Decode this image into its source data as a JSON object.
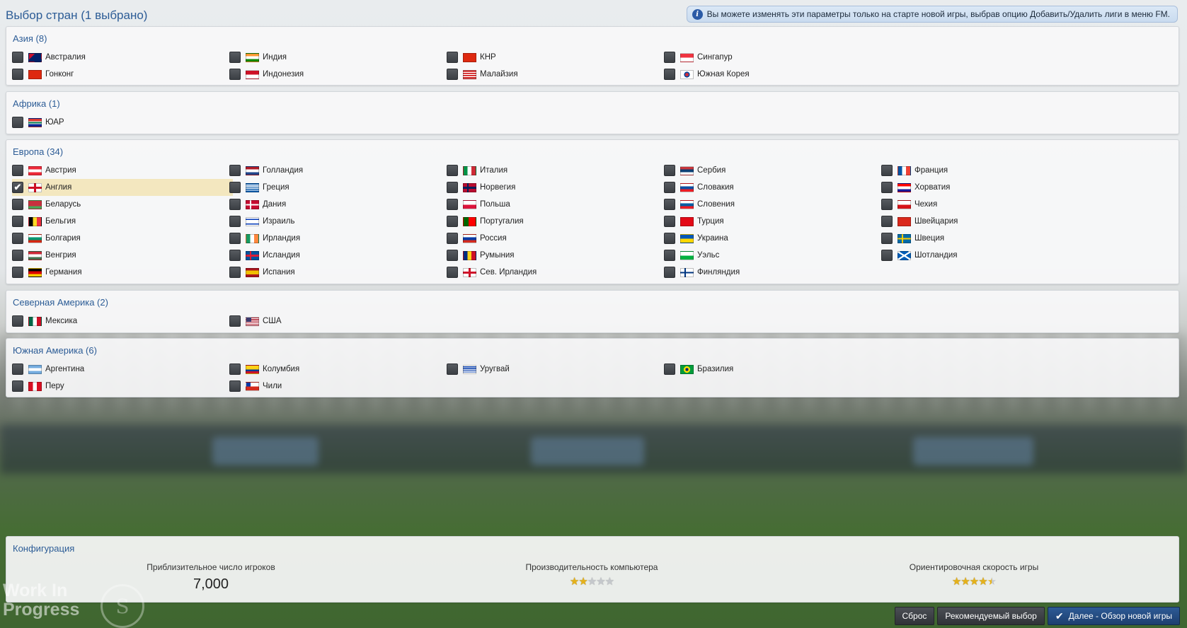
{
  "header": {
    "title": "Выбор стран (1 выбрано)",
    "notice": "Вы можете изменять эти параметры только на старте новой игры, выбрав опцию Добавить/Удалить лиги в меню FM."
  },
  "regions": {
    "asia": {
      "title": "Азия (8)",
      "items": [
        {
          "label": "Австралия",
          "checked": false
        },
        {
          "label": "Индия",
          "checked": false
        },
        {
          "label": "КНР",
          "checked": false
        },
        {
          "label": "Сингапур",
          "checked": false
        },
        {
          "label": "Гонконг",
          "checked": false
        },
        {
          "label": "Индонезия",
          "checked": false
        },
        {
          "label": "Малайзия",
          "checked": false
        },
        {
          "label": "Южная Корея",
          "checked": false
        }
      ]
    },
    "africa": {
      "title": "Африка (1)",
      "items": [
        {
          "label": "ЮАР",
          "checked": false
        }
      ]
    },
    "europe": {
      "title": "Европа (34)",
      "items": [
        {
          "label": "Австрия",
          "checked": false
        },
        {
          "label": "Голландия",
          "checked": false
        },
        {
          "label": "Италия",
          "checked": false
        },
        {
          "label": "Сербия",
          "checked": false
        },
        {
          "label": "Франция",
          "checked": false
        },
        {
          "label": "Англия",
          "checked": true
        },
        {
          "label": "Греция",
          "checked": false
        },
        {
          "label": "Норвегия",
          "checked": false
        },
        {
          "label": "Словакия",
          "checked": false
        },
        {
          "label": "Хорватия",
          "checked": false
        },
        {
          "label": "Беларусь",
          "checked": false
        },
        {
          "label": "Дания",
          "checked": false
        },
        {
          "label": "Польша",
          "checked": false
        },
        {
          "label": "Словения",
          "checked": false
        },
        {
          "label": "Чехия",
          "checked": false
        },
        {
          "label": "Бельгия",
          "checked": false
        },
        {
          "label": "Израиль",
          "checked": false
        },
        {
          "label": "Португалия",
          "checked": false
        },
        {
          "label": "Турция",
          "checked": false
        },
        {
          "label": "Швейцария",
          "checked": false
        },
        {
          "label": "Болгария",
          "checked": false
        },
        {
          "label": "Ирландия",
          "checked": false
        },
        {
          "label": "Россия",
          "checked": false
        },
        {
          "label": "Украина",
          "checked": false
        },
        {
          "label": "Швеция",
          "checked": false
        },
        {
          "label": "Венгрия",
          "checked": false
        },
        {
          "label": "Исландия",
          "checked": false
        },
        {
          "label": "Румыния",
          "checked": false
        },
        {
          "label": "Уэльс",
          "checked": false
        },
        {
          "label": "Шотландия",
          "checked": false
        },
        {
          "label": "Германия",
          "checked": false
        },
        {
          "label": "Испания",
          "checked": false
        },
        {
          "label": "Сев. Ирландия",
          "checked": false
        },
        {
          "label": "Финляндия",
          "checked": false
        }
      ]
    },
    "north_america": {
      "title": "Северная Америка (2)",
      "items": [
        {
          "label": "Мексика",
          "checked": false
        },
        {
          "label": "США",
          "checked": false
        }
      ]
    },
    "south_america": {
      "title": "Южная Америка (6)",
      "items": [
        {
          "label": "Аргентина",
          "checked": false
        },
        {
          "label": "Колумбия",
          "checked": false
        },
        {
          "label": "Уругвай",
          "checked": false
        },
        {
          "label": "Бразилия",
          "checked": false
        },
        {
          "label": "Перу",
          "checked": false
        },
        {
          "label": "Чили",
          "checked": false
        }
      ]
    }
  },
  "config": {
    "title": "Конфигурация",
    "players_label": "Приблизительное число игроков",
    "players_value": "7,000",
    "performance_label": "Производительность компьютера",
    "performance_stars": 2,
    "speed_label": "Ориентировочная скорость игры",
    "speed_stars": 4.5,
    "max_stars": 5
  },
  "buttons": {
    "reset": "Сброс",
    "recommended": "Рекомендуемый выбор",
    "next": "Далее - Обзор новой игры"
  },
  "watermark": {
    "line1": "Work In",
    "line2": "Progress"
  },
  "colors": {
    "accent": "#2c5c96",
    "selected_row": "#f3e7bf"
  }
}
